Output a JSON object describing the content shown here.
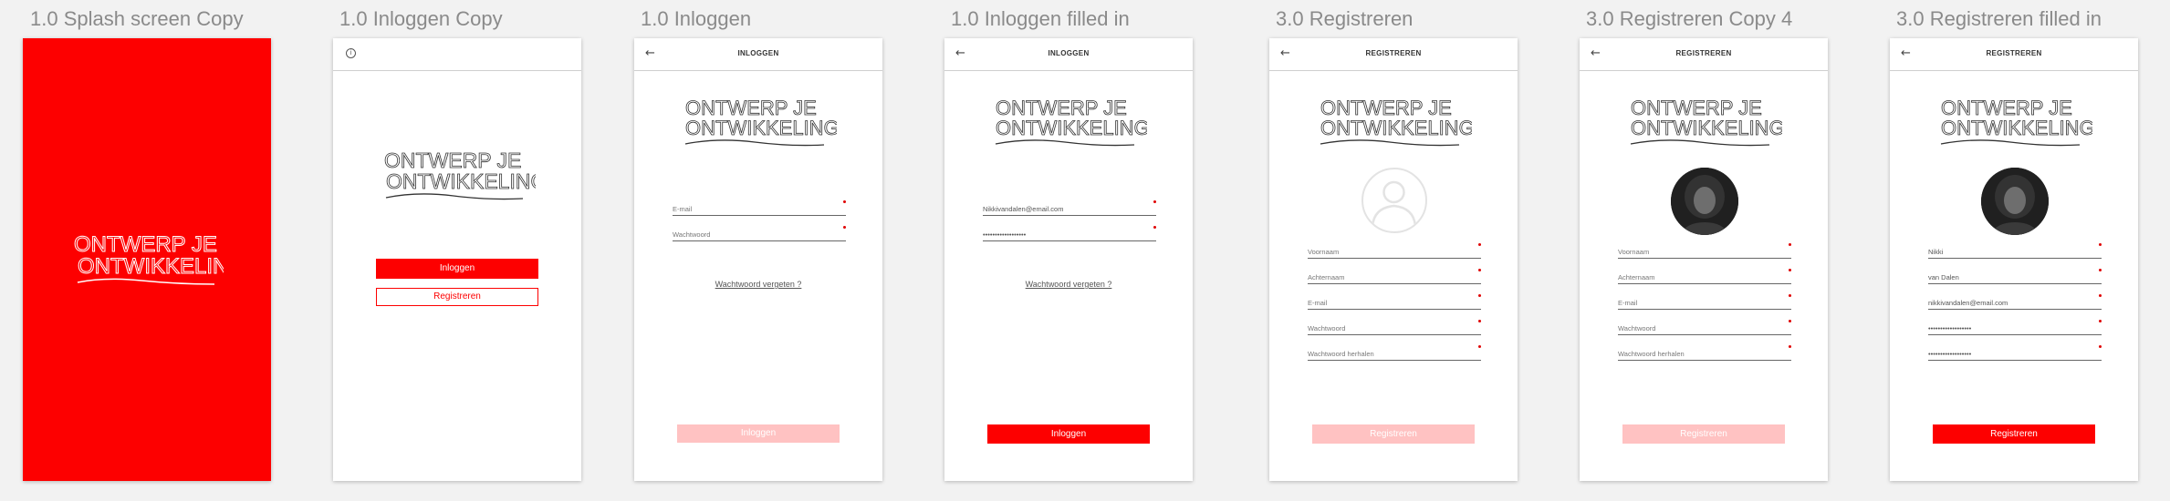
{
  "artboards": [
    {
      "title": "1.0 Splash screen Copy"
    },
    {
      "title": "1.0 Inloggen Copy"
    },
    {
      "title": "1.0 Inloggen"
    },
    {
      "title": "1.0 Inloggen filled in"
    },
    {
      "title": "3.0 Registreren"
    },
    {
      "title": "3.0 Registreren Copy 4"
    },
    {
      "title": "3.0 Registreren filled in"
    }
  ],
  "logo": {
    "line1": "ONTWERP JE",
    "line2": "ONTWIKKELING"
  },
  "colors": {
    "brand_red": "#fd0000",
    "disabled_red": "#ffc2c2",
    "background": "#f2f2f2"
  },
  "icons": {
    "back": "arrow-left-icon",
    "info": "info-icon",
    "avatar": "user-silhouette-icon"
  },
  "start": {
    "login_button": "Inloggen",
    "register_button": "Registreren"
  },
  "login": {
    "title": "INLOGGEN",
    "email_label": "E-mail",
    "password_label": "Wachtwoord",
    "forgot_link": "Wachtwoord vergeten ?",
    "submit_button": "Inloggen"
  },
  "login_filled": {
    "title": "INLOGGEN",
    "email_value": "Nikkivandalen@email.com",
    "password_value": "••••••••••••••••••",
    "forgot_link": "Wachtwoord vergeten ?",
    "submit_button": "Inloggen"
  },
  "register": {
    "title": "REGISTREREN",
    "firstname_label": "Voornaam",
    "lastname_label": "Achternaam",
    "email_label": "E-mail",
    "password_label": "Wachtwoord",
    "password_repeat_label": "Wachtwoord herhalen",
    "submit_button": "Registreren"
  },
  "register_filled": {
    "title": "REGISTREREN",
    "firstname_value": "Nikki",
    "lastname_value": "van Dalen",
    "email_value": "nikkivandalen@email.com",
    "password_value": "••••••••••••••••••",
    "password_repeat_value": "••••••••••••••••••",
    "submit_button": "Registreren"
  }
}
